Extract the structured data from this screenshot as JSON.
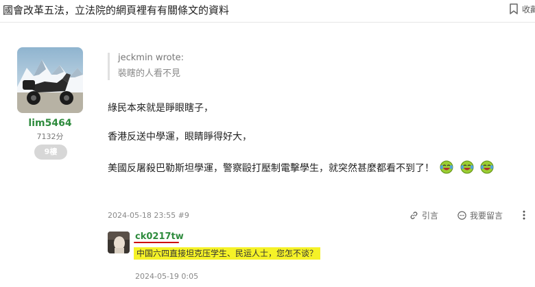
{
  "header": {
    "title": "國會改革五法，立法院的網頁裡有有關條文的資料",
    "bookmark_label": "收藏"
  },
  "post": {
    "author": {
      "username": "lim5464",
      "score": "7132分",
      "floor": "9樓"
    },
    "quote": {
      "author": "jeckmin wrote:",
      "text": "裝瞎的人看不見"
    },
    "paragraphs": [
      "綠民本來就是睜眼瞎子，",
      "香港反送中學運，眼睛睜得好大，",
      "美國反屠殺巴勒斯坦學運，警察毆打壓制電擊學生，就突然甚麼都看不到了！"
    ],
    "emoji_icons": [
      "laughing-tears-icon",
      "laughing-tears-icon",
      "laughing-tears-icon"
    ],
    "meta": "2024-05-18 23:55 #9",
    "actions": {
      "quote_label": "引言",
      "reply_label": "我要留言"
    }
  },
  "reply": {
    "username": "ck0217tw",
    "text": "中国六四直接坦克压学生、民运人士，您怎不谈？",
    "time": "2024-05-19 0:05"
  },
  "colors": {
    "username_green": "#2e8b3d",
    "highlight_yellow": "#f5f227",
    "annotation_red": "#cc0000"
  }
}
